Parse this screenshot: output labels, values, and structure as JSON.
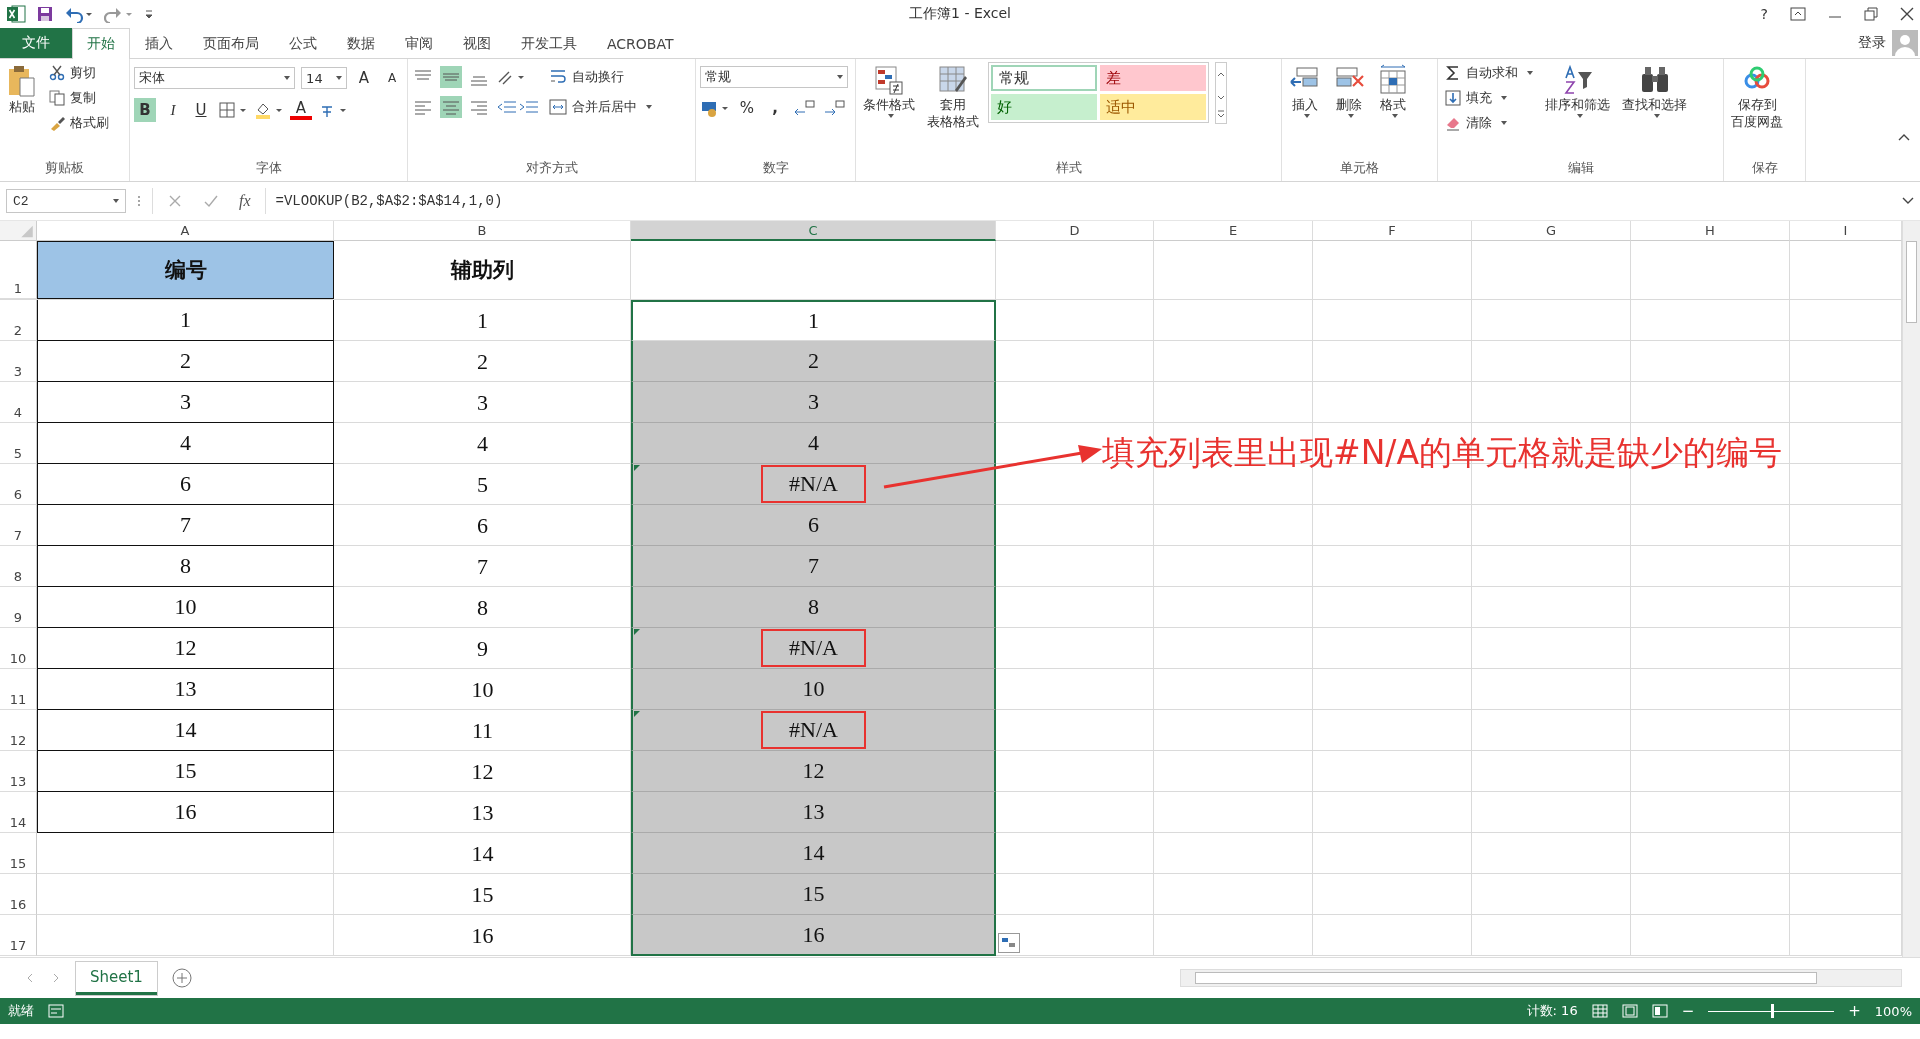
{
  "window": {
    "title": "工作簿1 - Excel",
    "help": "?",
    "sign_in": "登录"
  },
  "tabs": [
    {
      "label": "文件",
      "kind": "file",
      "selected": false
    },
    {
      "label": "开始",
      "kind": "tab",
      "selected": true
    },
    {
      "label": "插入",
      "kind": "tab",
      "selected": false
    },
    {
      "label": "页面布局",
      "kind": "tab",
      "selected": false
    },
    {
      "label": "公式",
      "kind": "tab",
      "selected": false
    },
    {
      "label": "数据",
      "kind": "tab",
      "selected": false
    },
    {
      "label": "审阅",
      "kind": "tab",
      "selected": false
    },
    {
      "label": "视图",
      "kind": "tab",
      "selected": false
    },
    {
      "label": "开发工具",
      "kind": "tab",
      "selected": false
    },
    {
      "label": "ACROBAT",
      "kind": "tab",
      "selected": false
    }
  ],
  "ribbon": {
    "clipboard": {
      "label": "剪贴板",
      "paste": "粘贴",
      "cut": "剪切",
      "copy": "复制",
      "painter": "格式刷"
    },
    "font": {
      "label": "字体",
      "family": "宋体",
      "size": "14",
      "grow": "A",
      "shrink": "A",
      "bold": {
        "text": "B",
        "selected": true
      },
      "italic": {
        "text": "I",
        "selected": false
      },
      "underline": {
        "text": "U",
        "selected": false
      },
      "color_letter": "A"
    },
    "alignment": {
      "label": "对齐方式",
      "middle_selected": true,
      "center_selected": true,
      "wrap": "自动换行",
      "merge": "合并后居中"
    },
    "number": {
      "label": "数字",
      "format": "常规",
      "percent": "%",
      "comma": ","
    },
    "styles": {
      "label": "样式",
      "conditional": "条件格式",
      "table_1": "套用",
      "table_2": "表格格式",
      "cells": [
        {
          "text": "常规",
          "kind": "normal"
        },
        {
          "text": "差",
          "kind": "bad"
        },
        {
          "text": "好",
          "kind": "good"
        },
        {
          "text": "适中",
          "kind": "neutral"
        }
      ]
    },
    "cells": {
      "label": "单元格",
      "items": [
        {
          "label": "插入",
          "kind": "insert"
        },
        {
          "label": "删除",
          "kind": "delete"
        },
        {
          "label": "格式",
          "kind": "format"
        }
      ]
    },
    "editing": {
      "label": "编辑",
      "autosum": "自动求和",
      "fill": "填充",
      "clear": "清除",
      "sort": "排序和筛选",
      "find": "查找和选择"
    },
    "save": {
      "label": "保存",
      "line_1": "保存到",
      "line_2": "百度网盘"
    }
  },
  "name_box": "C2",
  "fx": "fx",
  "formula": "=VLOOKUP(B2,$A$2:$A$14,1,0)",
  "columns": [
    {
      "label": "A",
      "selected": false
    },
    {
      "label": "B",
      "selected": false
    },
    {
      "label": "C",
      "selected": true
    },
    {
      "label": "D",
      "selected": false
    },
    {
      "label": "E",
      "selected": false
    },
    {
      "label": "F",
      "selected": false
    },
    {
      "label": "G",
      "selected": false
    },
    {
      "label": "H",
      "selected": false
    },
    {
      "label": "I",
      "selected": false
    }
  ],
  "header_row": {
    "n": "1",
    "a": "编号",
    "b": "辅助列"
  },
  "rows": [
    {
      "n": "2",
      "a": "1",
      "b": "1",
      "c": "1",
      "error": false
    },
    {
      "n": "3",
      "a": "2",
      "b": "2",
      "c": "2",
      "error": false
    },
    {
      "n": "4",
      "a": "3",
      "b": "3",
      "c": "3",
      "error": false
    },
    {
      "n": "5",
      "a": "4",
      "b": "4",
      "c": "4",
      "error": false
    },
    {
      "n": "6",
      "a": "6",
      "b": "5",
      "c": "#N/A",
      "error": true
    },
    {
      "n": "7",
      "a": "7",
      "b": "6",
      "c": "6",
      "error": false
    },
    {
      "n": "8",
      "a": "8",
      "b": "7",
      "c": "7",
      "error": false
    },
    {
      "n": "9",
      "a": "10",
      "b": "8",
      "c": "8",
      "error": false
    },
    {
      "n": "10",
      "a": "12",
      "b": "9",
      "c": "#N/A",
      "error": true
    },
    {
      "n": "11",
      "a": "13",
      "b": "10",
      "c": "10",
      "error": false
    },
    {
      "n": "12",
      "a": "14",
      "b": "11",
      "c": "#N/A",
      "error": true
    },
    {
      "n": "13",
      "a": "15",
      "b": "12",
      "c": "12",
      "error": false
    },
    {
      "n": "14",
      "a": "16",
      "b": "13",
      "c": "13",
      "error": false
    },
    {
      "n": "15",
      "a": null,
      "b": "14",
      "c": "14",
      "error": false
    },
    {
      "n": "16",
      "a": null,
      "b": "15",
      "c": "15",
      "error": false
    },
    {
      "n": "17",
      "a": null,
      "b": "16",
      "c": "16",
      "error": false
    }
  ],
  "annotation": "填充列表里出现#N/A的单元格就是缺少的编号",
  "sheets": [
    {
      "label": "Sheet1",
      "selected": true
    }
  ],
  "status": {
    "ready": "就绪",
    "count": "计数: 16",
    "zoom_out": "−",
    "zoom_in": "+",
    "zoom": "100%",
    "zoom_slider": {
      "level": 0.5
    }
  }
}
